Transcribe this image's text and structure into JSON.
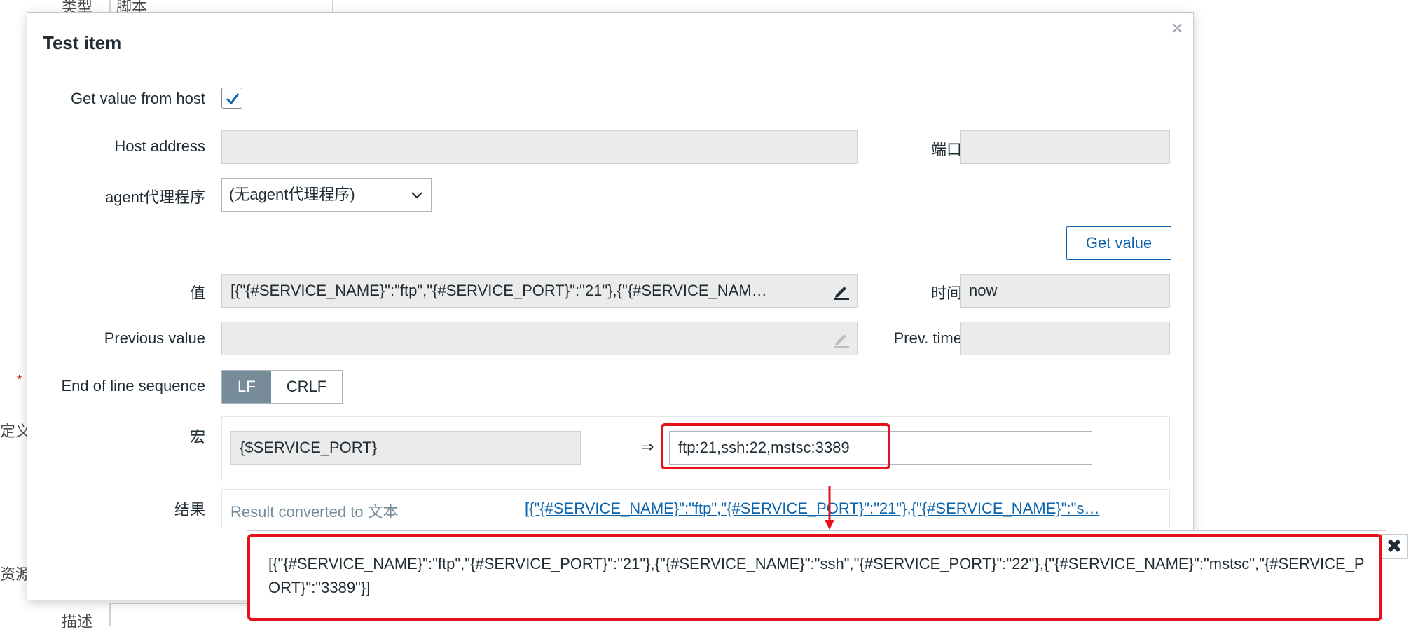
{
  "background": {
    "type_label": "类型",
    "type_value": "脚本",
    "define_label": "定义",
    "resource_label": "资源",
    "desc_label": "描述",
    "required_mark": "*"
  },
  "modal": {
    "title": "Test item",
    "close_icon": "×",
    "get_value_from_host": {
      "label": "Get value from host",
      "checked": true
    },
    "host_address": {
      "label": "Host address",
      "value": ""
    },
    "port": {
      "label": "端口",
      "value": ""
    },
    "proxy": {
      "label": "agent代理程序",
      "selected": "(无agent代理程序)"
    },
    "get_value_button": "Get value",
    "value": {
      "label": "值",
      "text": "[{\"{#SERVICE_NAME}\":\"ftp\",\"{#SERVICE_PORT}\":\"21\"},{\"{#SERVICE_NAM…"
    },
    "time": {
      "label": "时间",
      "value": "now"
    },
    "previous_value": {
      "label": "Previous value",
      "text": ""
    },
    "prev_time": {
      "label": "Prev. time",
      "value": ""
    },
    "eol": {
      "label": "End of line sequence",
      "options": [
        "LF",
        "CRLF"
      ],
      "selected": "LF"
    },
    "macro": {
      "label": "宏",
      "name": "{$SERVICE_PORT}",
      "arrow": "⇒",
      "value": "ftp:21,ssh:22,mstsc:3389"
    },
    "result": {
      "label": "结果",
      "converted": "Result converted to 文本",
      "link": "[{\"{#SERVICE_NAME}\":\"ftp\",\"{#SERVICE_PORT}\":\"21\"},{\"{#SERVICE_NAME}\":\"s…"
    }
  },
  "popup": {
    "text": "[{\"{#SERVICE_NAME}\":\"ftp\",\"{#SERVICE_PORT}\":\"21\"},{\"{#SERVICE_NAME}\":\"ssh\",\"{#SERVICE_PORT}\":\"22\"},{\"{#SERVICE_NAME}\":\"mstsc\",\"{#SERVICE_PORT}\":\"3389\"}]",
    "close_icon": "✖"
  },
  "colors": {
    "accent": "#0a63ad",
    "highlight": "#e5121b",
    "toggle_on": "#768d99"
  }
}
